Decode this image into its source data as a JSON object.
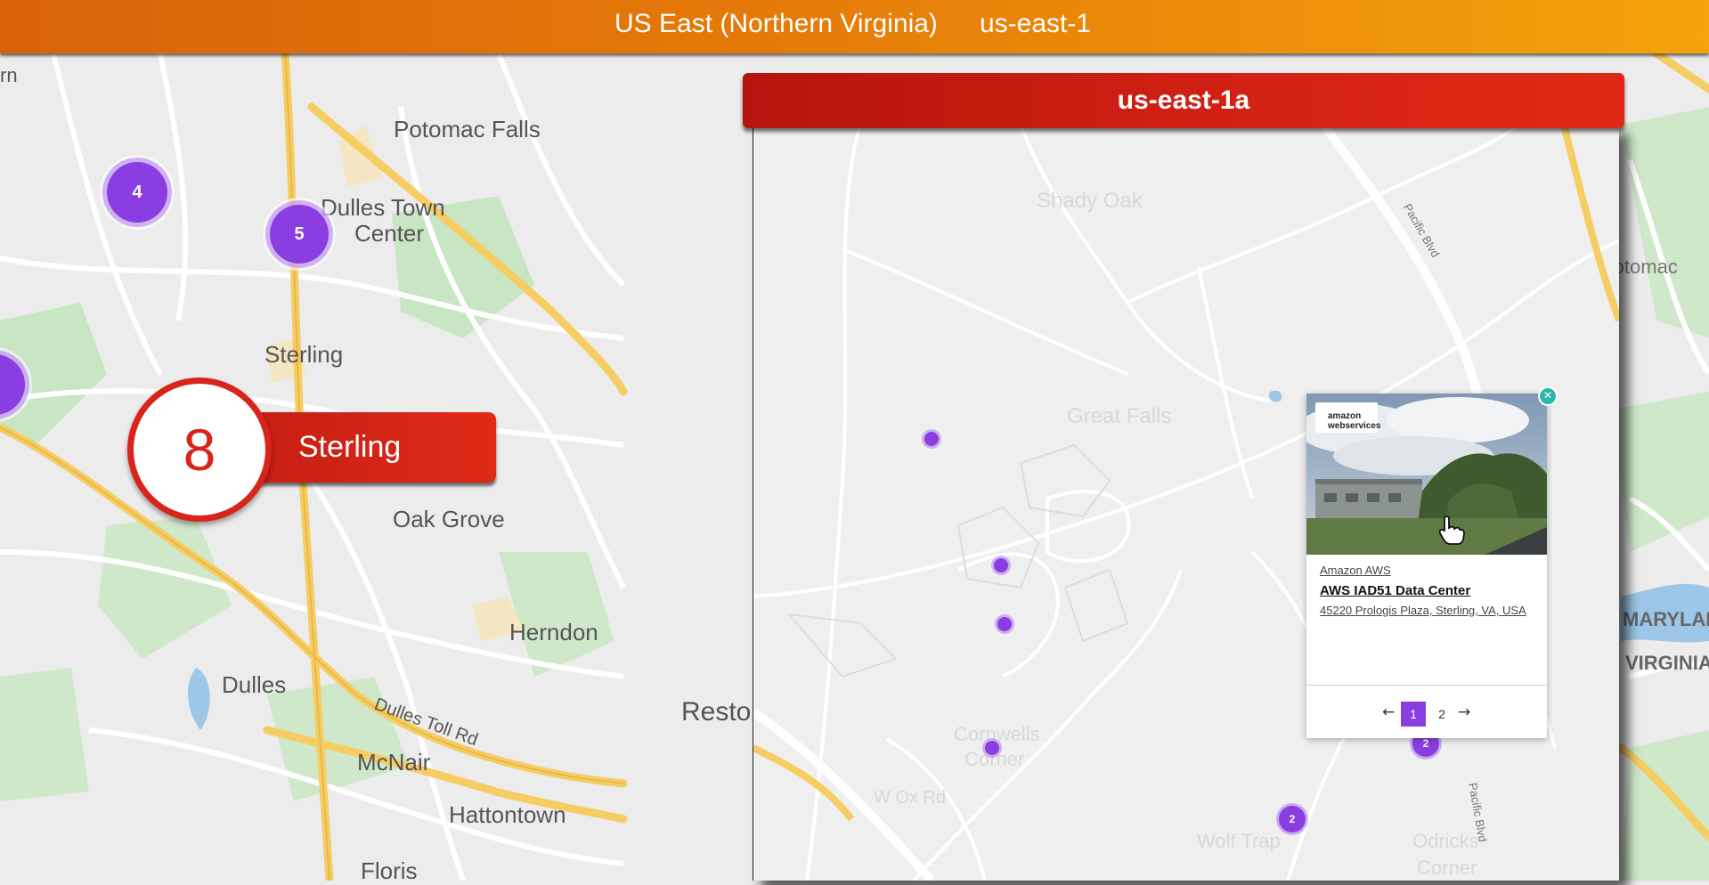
{
  "header": {
    "region_name": "US East (Northern Virginia)",
    "region_code": "us-east-1"
  },
  "background_map": {
    "place_labels": [
      "rn",
      "Potomac Falls",
      "Dulles Town",
      "Center",
      "Sterling",
      "Oak Grove",
      "Herndon",
      "Dulles",
      "Resto",
      "McNair",
      "Hattontown",
      "Floris",
      "Potomac",
      "MARYLAN",
      "VIRGINIA"
    ],
    "road_labels": [
      "Dulles Toll Rd"
    ],
    "clusters": [
      {
        "count": "4"
      },
      {
        "count": "5"
      }
    ]
  },
  "city_badge": {
    "count": "8",
    "city": "Sterling"
  },
  "zone_panel": {
    "title": "us-east-1a",
    "road_labels": [
      "Pacific Blvd",
      "Pacific Blvd"
    ],
    "faded_labels": [
      "Shady Oak",
      "Great Falls",
      "Cornwells",
      "Corner",
      "Wolf Trap",
      "Odricks",
      "Corner",
      "W Ox Rd"
    ],
    "clusters": [
      {
        "count": "2"
      },
      {
        "count": "2"
      }
    ]
  },
  "popup": {
    "logo_text": "amazon webservices",
    "provider": "Amazon AWS",
    "name": "AWS IAD51 Data Center",
    "address": "45220 Prologis Plaza, Sterling, VA, USA",
    "close_icon": "close-icon",
    "pagination": {
      "prev": "←",
      "pages": [
        "1",
        "2"
      ],
      "current": "1",
      "next": "→"
    }
  },
  "colors": {
    "header_gradient_start": "#d9620a",
    "header_gradient_end": "#f4a30b",
    "accent_red": "#d8241a",
    "cluster_purple": "#8a3de0",
    "close_teal": "#2bb8a8"
  }
}
